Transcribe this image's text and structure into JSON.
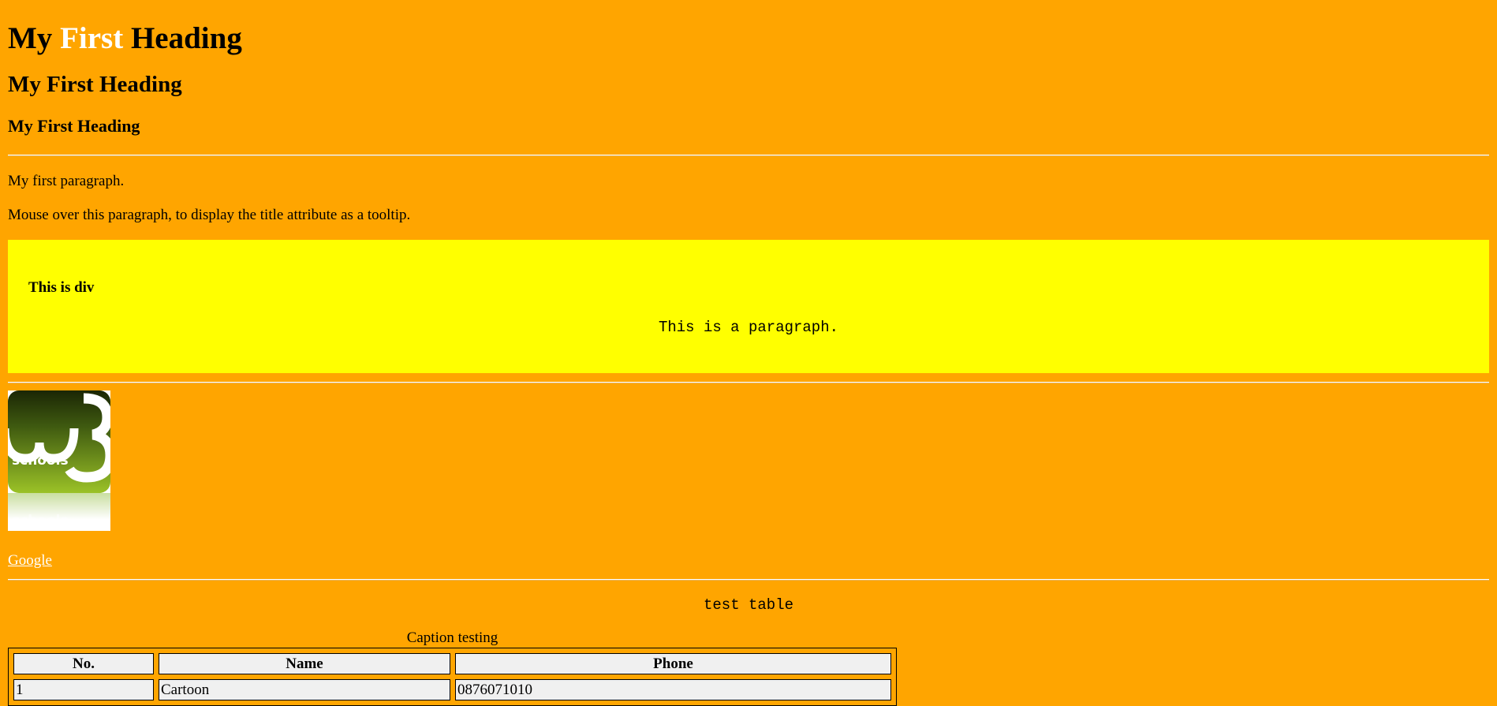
{
  "headings": {
    "h1_part1": "My ",
    "h1_highlight": "First",
    "h1_part2": " Heading",
    "h2": "My First Heading",
    "h3": "My First Heading"
  },
  "paragraphs": {
    "first": "My first paragraph.",
    "tooltip": "Mouse over this paragraph, to display the title attribute as a tooltip."
  },
  "div_section": {
    "title": "This is div",
    "paragraph": "This is a paragraph."
  },
  "logo": {
    "text": "schools",
    "digit": "3",
    "colors": {
      "top": "#1e2a06",
      "bottom": "#9bc227"
    }
  },
  "link": {
    "label": "Google"
  },
  "table_section": {
    "title": "test table",
    "caption": "Caption testing",
    "headers": [
      "No.",
      "Name",
      "Phone"
    ],
    "rows": [
      [
        "1",
        "Cartoon",
        "0876071010"
      ]
    ]
  },
  "colors": {
    "background": "#FFA500",
    "div_background": "#FFFF00",
    "link": "#FFFFFF",
    "heading_highlight": "#FFFFFF"
  }
}
